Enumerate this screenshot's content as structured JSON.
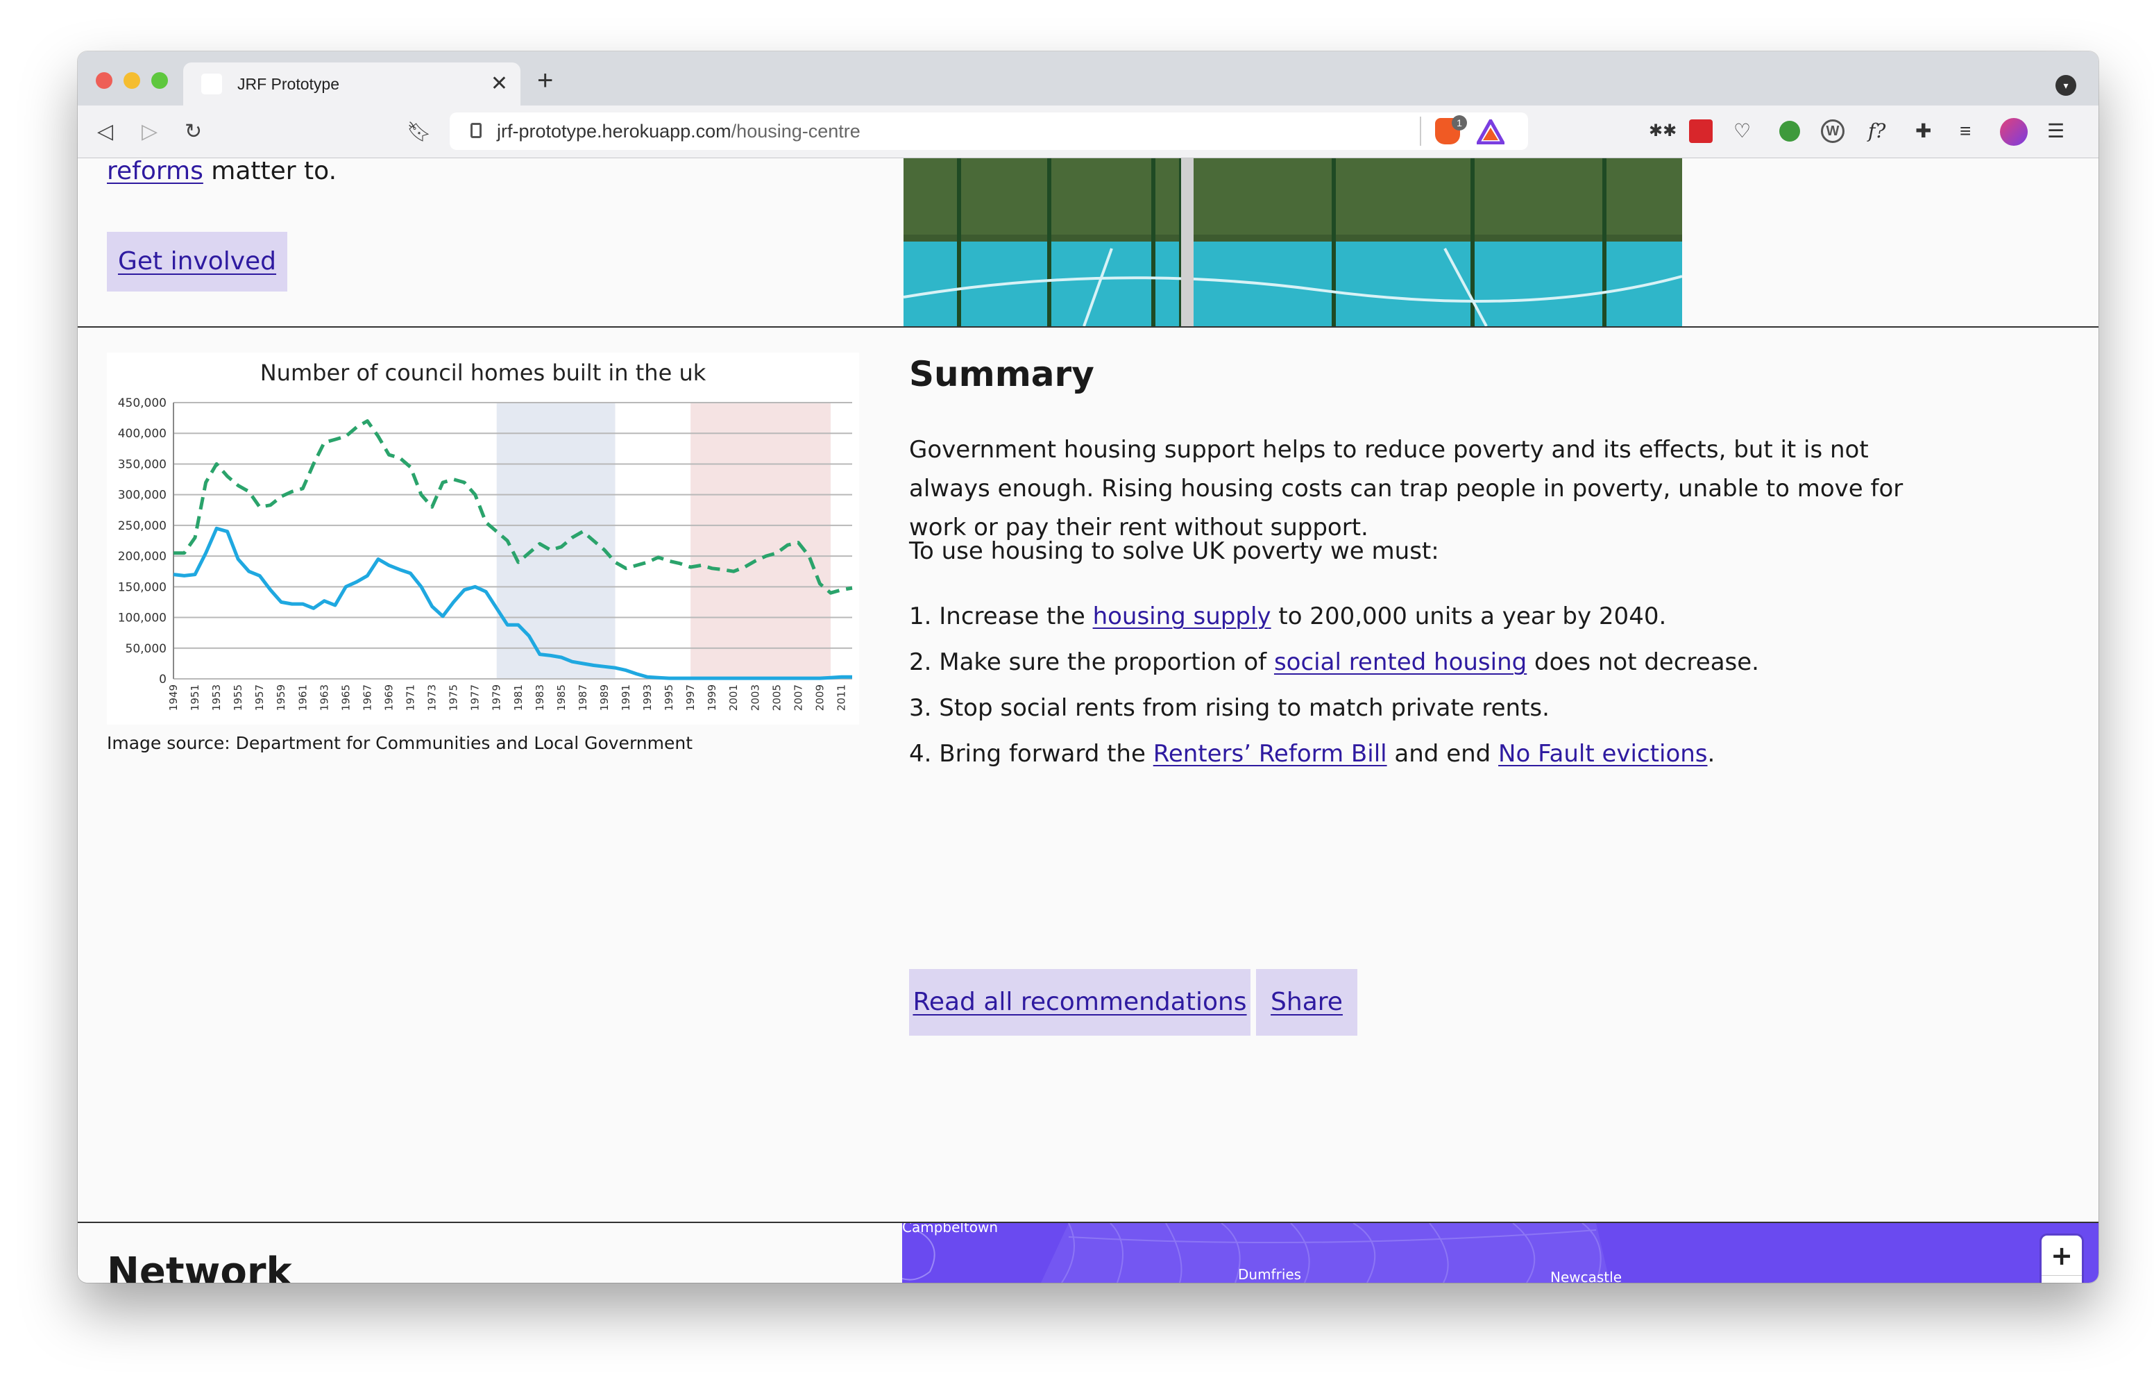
{
  "browser": {
    "tab_title": "JRF Prototype",
    "url_host": "jrf-prototype.herokuapp.com",
    "url_path": "/housing-centre",
    "new_tab": "+",
    "close_tab": "✕",
    "brave_count": "1"
  },
  "hero": {
    "link_text": "reforms",
    "trailing_text": " matter to.",
    "button_label": "Get involved"
  },
  "chart_data": {
    "type": "line",
    "title": "Number of council homes built in the uk",
    "xlabel": "",
    "ylabel": "",
    "ylim": [
      0,
      450000
    ],
    "y_ticks": [
      "450,000",
      "400,000",
      "350,000",
      "300,000",
      "250,000",
      "200,000",
      "150,000",
      "100,000",
      "50,000",
      "0"
    ],
    "x": [
      1949,
      1950,
      1951,
      1952,
      1953,
      1954,
      1955,
      1956,
      1957,
      1958,
      1959,
      1960,
      1961,
      1962,
      1963,
      1964,
      1965,
      1966,
      1967,
      1968,
      1969,
      1970,
      1971,
      1972,
      1973,
      1974,
      1975,
      1976,
      1977,
      1978,
      1979,
      1980,
      1981,
      1982,
      1983,
      1984,
      1985,
      1986,
      1987,
      1988,
      1989,
      1990,
      1991,
      1992,
      1993,
      1994,
      1995,
      1996,
      1997,
      1998,
      1999,
      2000,
      2001,
      2002,
      2003,
      2004,
      2005,
      2006,
      2007,
      2008,
      2009,
      2010,
      2011,
      2012
    ],
    "x_ticks": [
      "1949",
      "1951",
      "1953",
      "1955",
      "1957",
      "1959",
      "1961",
      "1963",
      "1965",
      "1967",
      "1969",
      "1971",
      "1973",
      "1975",
      "1977",
      "1979",
      "1981",
      "1983",
      "1985",
      "1987",
      "1989",
      "1991",
      "1993",
      "1995",
      "1997",
      "1999",
      "2001",
      "2003",
      "2005",
      "2007",
      "2009",
      "2011"
    ],
    "shaded_ranges": [
      [
        1979,
        1990
      ],
      [
        1997,
        2010
      ]
    ],
    "shade_colors": [
      "#e4e9f2",
      "#f5e3e3"
    ],
    "series": [
      {
        "color": "#2aa36b",
        "dash": true,
        "values": [
          205000,
          205000,
          230000,
          320000,
          350000,
          330000,
          315000,
          305000,
          280000,
          283000,
          297000,
          305000,
          310000,
          350000,
          385000,
          390000,
          395000,
          410000,
          420000,
          395000,
          365000,
          360000,
          345000,
          300000,
          280000,
          320000,
          325000,
          320000,
          300000,
          255000,
          240000,
          225000,
          190000,
          205000,
          220000,
          210000,
          215000,
          230000,
          240000,
          225000,
          210000,
          190000,
          180000,
          185000,
          190000,
          198000,
          192000,
          188000,
          182000,
          185000,
          180000,
          178000,
          175000,
          182000,
          192000,
          200000,
          205000,
          218000,
          222000,
          200000,
          155000,
          140000,
          145000,
          148000
        ]
      },
      {
        "color": "#1fa8e0",
        "dash": false,
        "values": [
          170000,
          168000,
          170000,
          205000,
          245000,
          240000,
          195000,
          175000,
          168000,
          145000,
          125000,
          122000,
          122000,
          115000,
          127000,
          120000,
          150000,
          158000,
          168000,
          195000,
          185000,
          178000,
          172000,
          150000,
          118000,
          102000,
          125000,
          145000,
          150000,
          142000,
          115000,
          88000,
          88000,
          70000,
          40000,
          38000,
          35000,
          28000,
          25000,
          22000,
          20000,
          18000,
          14000,
          8000,
          3000,
          2000,
          1000,
          1000,
          1000,
          1000,
          1000,
          1000,
          1000,
          1000,
          1000,
          1000,
          1000,
          1000,
          1000,
          1000,
          1000,
          2000,
          3000,
          3000
        ]
      }
    ],
    "source": "Image source: Department for Communities and Local Government"
  },
  "summary": {
    "heading": "Summary",
    "para1": "Government housing support helps to reduce poverty and its effects, but it is not always enough. Rising housing costs can trap people in poverty, unable to move for work or pay their rent without support.",
    "para2": "To use housing to solve UK poverty we must:",
    "items": [
      {
        "pre": "Increase the ",
        "link": "housing supply",
        "post": " to 200,000 units a year by 2040."
      },
      {
        "pre": "Make sure the proportion of ",
        "link": "social rented housing",
        "post": " does not decrease."
      },
      {
        "pre": "Stop social rents from rising to match private rents.",
        "link": "",
        "post": ""
      },
      {
        "pre": "Bring forward the ",
        "link": "Renters’ Reform Bill",
        "post": " and end ",
        "link2": "No Fault evictions",
        "post2": "."
      }
    ],
    "read_all": "Read all recommendations",
    "share": "Share"
  },
  "network": {
    "heading": "Network",
    "map_labels": [
      "Campbeltown",
      "Dumfries",
      "Newcastle"
    ],
    "zoom_in": "+",
    "zoom_out": "−"
  },
  "colors": {
    "accent": "#2e1aa0",
    "button_bg": "#dcd6f2",
    "map_bg": "#6a4af0"
  }
}
